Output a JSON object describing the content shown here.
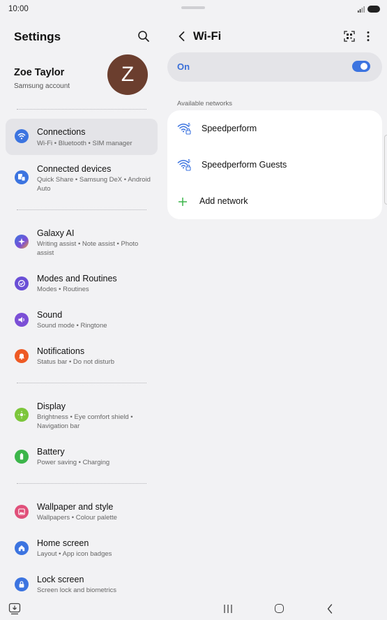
{
  "status_bar": {
    "time": "10:00"
  },
  "left": {
    "title": "Settings",
    "profile": {
      "name": "Zoe Taylor",
      "sub": "Samsung account",
      "avatar_letter": "Z",
      "avatar_color": "#6b3e2e"
    },
    "items": [
      {
        "label": "Connections",
        "sub": "Wi-Fi  •  Bluetooth  •  SIM manager",
        "icon": "wifi-icon",
        "color": "#3c74e0"
      },
      {
        "label": "Connected devices",
        "sub": "Quick Share  •  Samsung DeX  •  Android Auto",
        "icon": "connected-devices-icon",
        "color": "#3c74e0"
      },
      {
        "label": "Galaxy AI",
        "sub": "Writing assist  •  Note assist  •  Photo assist",
        "icon": "galaxy-ai-icon",
        "color": "#3c74e0"
      },
      {
        "label": "Modes and Routines",
        "sub": "Modes  •  Routines",
        "icon": "modes-icon",
        "color": "#6a4fd6"
      },
      {
        "label": "Sound",
        "sub": "Sound mode  •  Ringtone",
        "icon": "sound-icon",
        "color": "#7b4fd6"
      },
      {
        "label": "Notifications",
        "sub": "Status bar  •  Do not disturb",
        "icon": "bell-icon",
        "color": "#ee5a24"
      },
      {
        "label": "Display",
        "sub": "Brightness  •  Eye comfort shield  •  Navigation bar",
        "icon": "display-icon",
        "color": "#7cc63a"
      },
      {
        "label": "Battery",
        "sub": "Power saving  •  Charging",
        "icon": "battery-icon",
        "color": "#3cb54a"
      },
      {
        "label": "Wallpaper and style",
        "sub": "Wallpapers  •  Colour palette",
        "icon": "wallpaper-icon",
        "color": "#e0507a"
      },
      {
        "label": "Home screen",
        "sub": "Layout  •  App icon badges",
        "icon": "home-icon",
        "color": "#3c74e0"
      },
      {
        "label": "Lock screen",
        "sub": "Screen lock and biometrics",
        "icon": "lock-icon",
        "color": "#3c74e0"
      }
    ]
  },
  "right": {
    "title": "Wi-Fi",
    "toggle": {
      "label": "On",
      "state": true
    },
    "section_title": "Available networks",
    "networks": [
      {
        "name": "Speedperform",
        "icon": "wifi-secured-icon"
      },
      {
        "name": "Speedperform Guests",
        "icon": "wifi-secured-icon"
      }
    ],
    "add_label": "Add network",
    "accent_color": "#3c74e0"
  }
}
